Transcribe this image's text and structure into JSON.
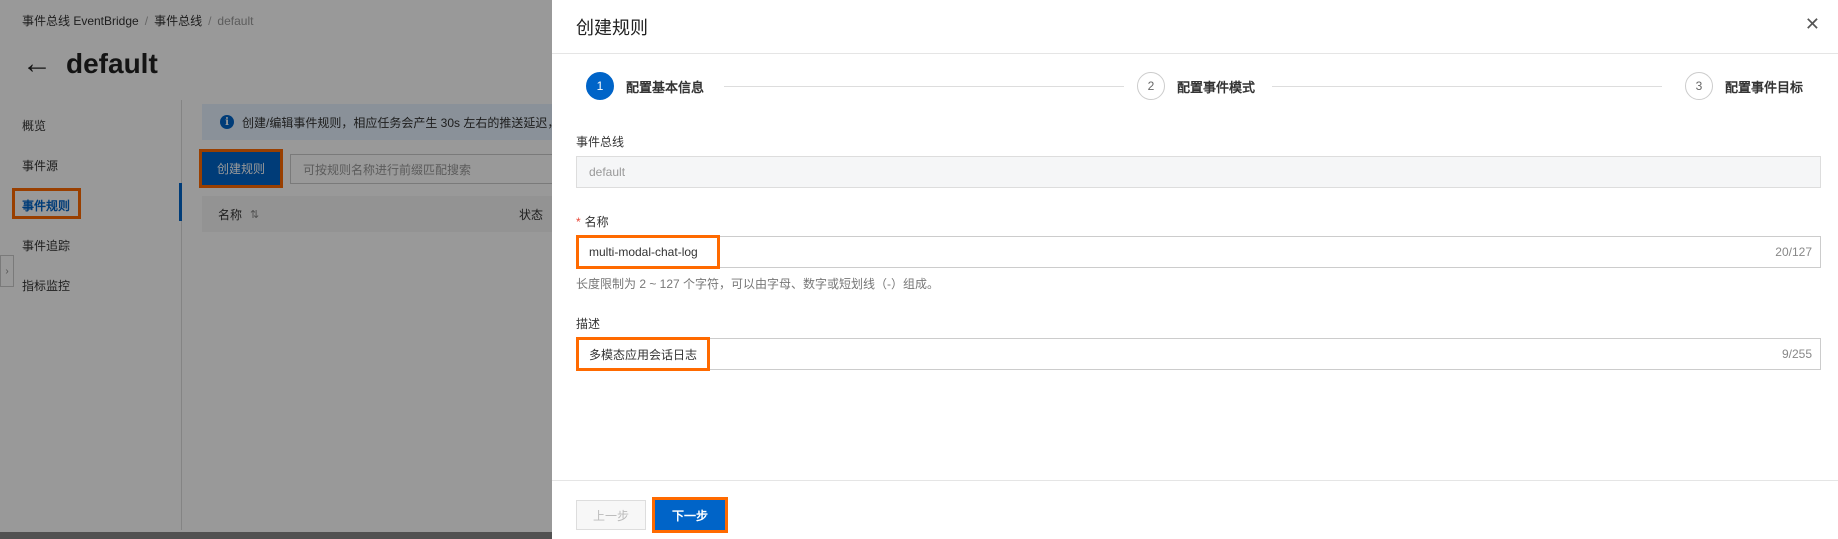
{
  "breadcrumb": {
    "item1": "事件总线 EventBridge",
    "sep": "/",
    "item2": "事件总线",
    "item3": "default"
  },
  "page": {
    "back_icon": "arrow-left-icon",
    "title": "default"
  },
  "sidebar": {
    "items": [
      {
        "label": "概览"
      },
      {
        "label": "事件源"
      },
      {
        "label": "事件规则"
      },
      {
        "label": "事件追踪"
      },
      {
        "label": "指标监控"
      }
    ],
    "active": "事件规则",
    "collapse_icon": "chevron-right-icon"
  },
  "main": {
    "banner_icon": "info-icon",
    "banner_text": "创建/编辑事件规则，相应任务会产生 30s 左右的推送延迟，",
    "create_button": "创建规则",
    "search_placeholder": "可按规则名称进行前缀匹配搜索",
    "table": {
      "col_name": "名称",
      "sort_icon": "sort-icon",
      "col_status": "状态"
    }
  },
  "drawer": {
    "title": "创建规则",
    "close_icon": "close-icon",
    "steps": [
      {
        "num": "1",
        "label": "配置基本信息",
        "active": true
      },
      {
        "num": "2",
        "label": "配置事件模式",
        "active": false
      },
      {
        "num": "3",
        "label": "配置事件目标",
        "active": false
      }
    ],
    "bus_label": "事件总线",
    "bus_value": "default",
    "name_required": "*",
    "name_label": "名称",
    "name_value": "multi-modal-chat-log",
    "name_counter": "20/127",
    "name_hint": "长度限制为 2 ~ 127 个字符，可以由字母、数字或短划线（-）组成。",
    "desc_label": "描述",
    "desc_value": "多模态应用会话日志",
    "desc_counter": "9/255",
    "prev_button": "上一步",
    "next_button": "下一步"
  },
  "colors": {
    "primary": "#0064c8",
    "highlight": "#ff6a00"
  }
}
